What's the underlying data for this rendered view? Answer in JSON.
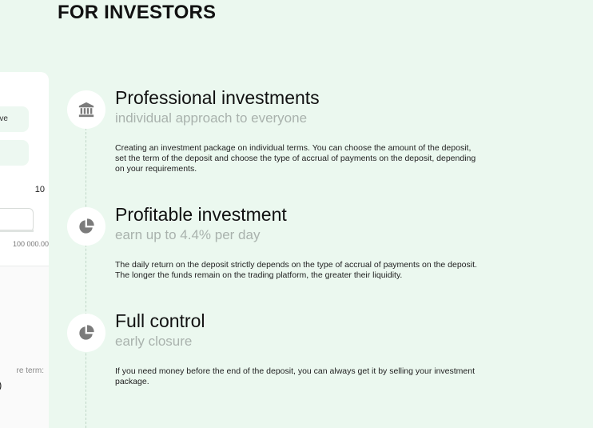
{
  "section": {
    "title": "FOR INVESTORS"
  },
  "calculator": {
    "plan_option_partial": "sive",
    "value_partial": "10",
    "max_amount_partial": "100 000.00",
    "term_label_partial": "re term:",
    "term_value_partial": ")"
  },
  "features": [
    {
      "icon": "bank-icon",
      "title": "Professional investments",
      "subtitle": "individual approach to everyone",
      "description": "Creating an investment package on individual terms. You can choose the amount of the deposit, set the term of the deposit and choose the type of accrual of payments on the deposit, depending on your requirements."
    },
    {
      "icon": "pie-chart-icon",
      "title": "Profitable investment",
      "subtitle": "earn up to 4.4% per day",
      "description": "The daily return on the deposit strictly depends on the type of accrual of payments on the deposit. The longer the funds remain on the trading platform, the greater their liquidity."
    },
    {
      "icon": "pie-chart-icon",
      "title": "Full control",
      "subtitle": "early closure",
      "description": "If you need money before the end of the deposit, you can always get it by selling your investment package."
    }
  ],
  "colors": {
    "background": "#ebf8ef",
    "icon": "#7b7b7b",
    "subtitle": "#a9b2ad"
  }
}
